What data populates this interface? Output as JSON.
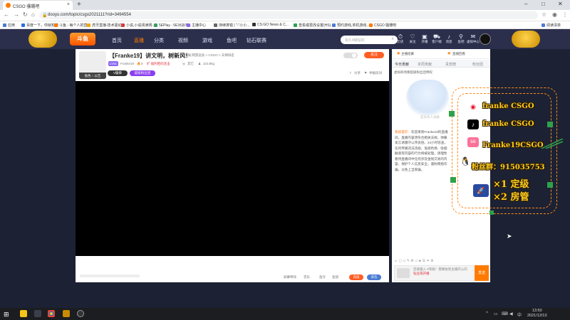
{
  "browser": {
    "tab_title": "CSGO 骚珊吧",
    "new_tab": "+",
    "url": "douyu.com/topic/csgo2021111?rid=3494554",
    "window_controls": [
      "–",
      "□",
      "✕"
    ],
    "bookmarks": [
      {
        "label": "应用",
        "color": "#4a7bd4"
      },
      {
        "label": "百度一下，你就知道",
        "color": "#2b6de2"
      },
      {
        "label": "斗鱼 - 每个人的直...",
        "color": "#ff7a00"
      },
      {
        "label": "虎牙直播-技术驱动...",
        "color": "#f4a900"
      },
      {
        "label": "小说,小说阅读网-...",
        "color": "#d43c3c"
      },
      {
        "label": "5EPlay - 5E对战平...",
        "color": "#3a9e5f"
      },
      {
        "label": "主播中心",
        "color": "#8a67f4"
      },
      {
        "label": "持续排错 | \"-\"小小...",
        "color": "#666"
      },
      {
        "label": "CS:GO News & C...",
        "color": "#333"
      },
      {
        "label": "查看或更改设置(HS)...",
        "color": "#2ea14b"
      },
      {
        "label": "预约游戏,单机游戏...",
        "color": "#4a7bd4"
      },
      {
        "label": "CSGO 骚珊吧",
        "color": "#ff7a00"
      },
      {
        "label": "阅读清单",
        "color": "#4a7bd4"
      }
    ]
  },
  "site_header": {
    "logo": "斗鱼",
    "nav": [
      "首页",
      "直播",
      "分类",
      "视频",
      "游戏",
      "鱼吧",
      "钻石联赛"
    ],
    "nav_active_index": 1,
    "search_placeholder": "永久4级钻石",
    "icons": [
      {
        "glyph": "⏱",
        "label": "历史"
      },
      {
        "glyph": "♡",
        "label": "关注"
      },
      {
        "glyph": "▣",
        "label": "开播"
      },
      {
        "glyph": "⛟",
        "label": "客户端"
      },
      {
        "glyph": "♪",
        "label": "消息"
      },
      {
        "glyph": "⚲",
        "label": "鱼吧"
      },
      {
        "glyph": "✉",
        "label": "虚拟中心"
      }
    ]
  },
  "room": {
    "thumb_badge": "角色 ↑ 公告",
    "title": "【Franke19】讲文明，树新风！",
    "tags": "举报   网游竞技 > CSGO > 天梯排名",
    "level": "LV51",
    "streamer": "Franke19",
    "heat": "0",
    "tag_red": "扩 福利密码连击",
    "location": "其它",
    "followers": "223.8kg",
    "badge1": "V徽章",
    "badge2": "超级粉丝团",
    "share": "分享",
    "report": "举报房间",
    "follow_button": "关注",
    "bottom_controls": [
      "屏幕特效",
      "音乐",
      "鱼仔",
      "鱼翅"
    ],
    "send_gift": "充值",
    "send_btn2": "背包"
  },
  "chat_panel": {
    "top_left": "主播招募",
    "top_right": "直播回看",
    "tabs": [
      "今日贡献",
      "本周贡献",
      "贵宾榜",
      "粉丝团"
    ],
    "tabs_active_index": 0,
    "notice": "虚拟商场要超级粉丝团特权",
    "bubble_text": "还未有人贡献",
    "system_label": "系统提示：",
    "system_message": "欢迎来到Franke19的直播间。直播内容须符合相关法规，弹幕发言请遵守公序良俗。24小时巡查，任何传播违法违规、低俗色情、吸烟酗酒等内容的行为将被处理，请理性看待直播间中任何涉及金钱交易的内容，保护个人信息安全，谨防网络诈骗。以免上当受骗。",
    "input_hint": "还能输入 #等级！需要收到主播开心的 ",
    "input_hint_red": "钻豆或开播",
    "send_label": "发送"
  },
  "overlay": {
    "weibo": "franke CSGO",
    "douyin": "franke CSGO",
    "bili": "Franke19CSGO",
    "qq": "粉丝群：915035753",
    "role1": "×1 定级",
    "role2": "×2 房管",
    "accent": "#ffcc21"
  },
  "taskbar": {
    "time": "13:50",
    "date": "2021/12/13",
    "tray_icons": [
      "^",
      "▭",
      "⌨",
      "◀",
      "中"
    ]
  }
}
